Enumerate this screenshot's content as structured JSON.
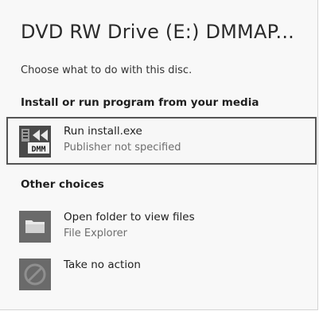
{
  "dialog": {
    "title": "DVD RW Drive (E:) DMMAP...",
    "subtitle": "Choose what to do with this disc."
  },
  "sections": [
    {
      "heading": "Install or run program from your media",
      "options": [
        {
          "label": "Run install.exe",
          "sub": "Publisher not specified",
          "icon": "dmm-installer-icon",
          "icon_text": "DMM",
          "selected": true
        }
      ]
    },
    {
      "heading": "Other choices",
      "options": [
        {
          "label": "Open folder to view files",
          "sub": "File Explorer",
          "icon": "folder-icon",
          "selected": false
        },
        {
          "label": "Take no action",
          "sub": "",
          "icon": "no-action-icon",
          "selected": false
        }
      ]
    }
  ],
  "colors": {
    "background": "#f8f8f8",
    "selected_border": "#545454",
    "primary_text": "#1f1f1f",
    "secondary_text": "#6e6e6e",
    "icon_gray": "#6a6a6a"
  }
}
